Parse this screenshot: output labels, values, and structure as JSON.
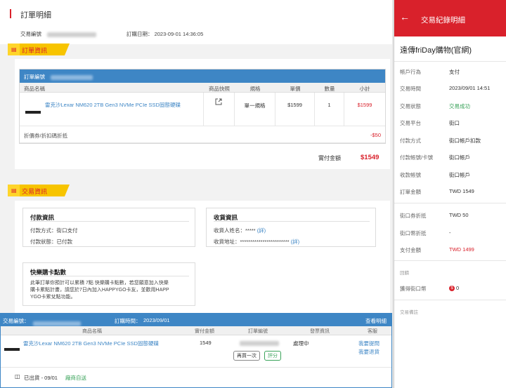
{
  "page": {
    "title": "訂單明細",
    "trade_no_label": "交易編號",
    "order_date_label": "訂購日期：",
    "order_date_value": "2023-09-01 14:36:05"
  },
  "order_info": {
    "tag": "訂單資訊",
    "table_head_label": "訂單編號",
    "columns": [
      "商品名稱",
      "商品快照",
      "規格",
      "單價",
      "數量",
      "小計"
    ],
    "product": {
      "name": "雷克沙Lexar NM620 2TB Gen3 NVMe PCIe SSD固態硬碟",
      "spec": "單一規格",
      "price": "$1599",
      "qty": "1",
      "subtotal": "$1599"
    },
    "discount_label": "折價券/折扣碼折抵",
    "discount_value": "-$50",
    "total_label": "實付金額",
    "total_value": "$1549"
  },
  "trade_info": {
    "tag": "交易資訊",
    "payment": {
      "title": "付款資訊",
      "method_label": "付款方式：",
      "method_value": "街口支付",
      "status_label": "付款狀態：",
      "status_value": "已付款"
    },
    "receiver": {
      "title": "收貨資訊",
      "name_label": "收貨人姓名：",
      "name_value": "*****",
      "name_link": "(詳)",
      "addr_label": "收貨地址：",
      "addr_value": "************************",
      "addr_link": "(詳)"
    },
    "points": {
      "title": "快樂購卡點數",
      "line1": "此筆訂單你預計可以累積 7點 快樂購卡點數，若您願意加入快樂",
      "line2": "購卡累點計畫，請您於7日內加入HAPPYGO卡友，並歡用HAPP",
      "line3": "YGO卡累兌點功能。"
    }
  },
  "strip": {
    "trade_no_label": "交易編號：",
    "order_time_label": "訂購時間：",
    "order_time_value": "2023/09/01",
    "detail_link": "查看明細",
    "cols": [
      "商品名稱",
      "實付金額",
      "訂單編號",
      "發票資訊",
      "客服"
    ],
    "product_name": "雷克沙Lexar NM620 2TB Gen3 NVMe PCIe SSD固態硬碟",
    "amount": "1549",
    "btn_rebuy": "再買一次",
    "btn_rate": "評分",
    "invoice": "處理中",
    "cs1": "我要提問",
    "cs2": "我要退貨",
    "ship_status": "已出貨 - 09/01",
    "ship_link": "廠商自送"
  },
  "panel": {
    "title": "交易紀錄明細",
    "merchant": "遠傳friDay購物(官網)",
    "rows1": [
      {
        "k": "帳戶行為",
        "v": "支付"
      },
      {
        "k": "交易時間",
        "v": "2023/09/01 14:51"
      },
      {
        "k": "交易狀態",
        "v": "交易成功"
      },
      {
        "k": "交易平台",
        "v": "街口"
      },
      {
        "k": "付款方式",
        "v": "街口帳戶扣款"
      },
      {
        "k": "付款帳號/卡號",
        "v": "街口帳戶"
      },
      {
        "k": "收款帳號",
        "v": "街口帳戶"
      },
      {
        "k": "訂單金額",
        "v": "TWD 1549"
      }
    ],
    "rows2": [
      {
        "k": "街口券折抵",
        "v": "TWD 50"
      },
      {
        "k": "街口幣折抵",
        "v": "-"
      },
      {
        "k": "支付金額",
        "v": "TWD 1499"
      }
    ],
    "cashback_label": "回饋",
    "earned_label": "獲得街口幣",
    "earned_value": "0",
    "note_label": "交易備註",
    "colors": {
      "accent": "#d9212b",
      "success": "#3aa35a",
      "link": "#3e86c5"
    }
  }
}
